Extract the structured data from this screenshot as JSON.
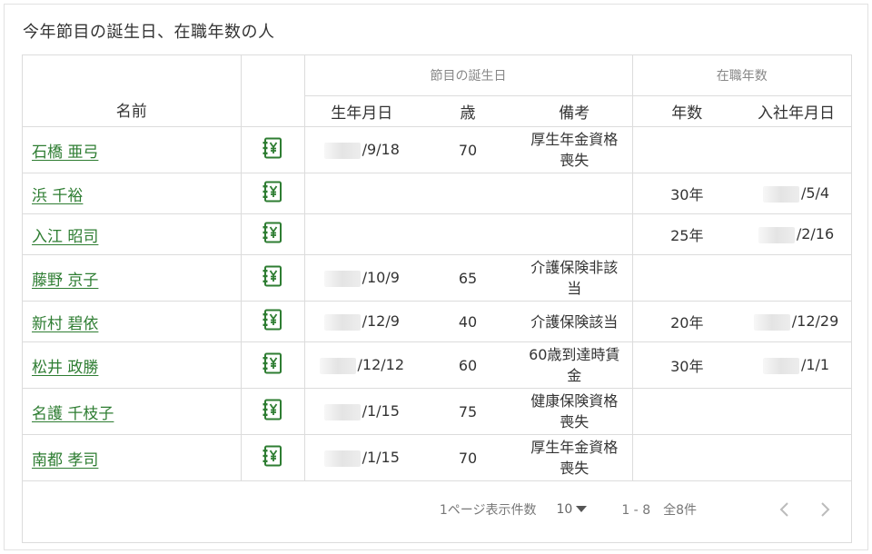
{
  "card_title": "今年節目の誕生日、在職年数の人",
  "headers": {
    "group_birthday": "節目の誕生日",
    "group_tenure": "在職年数",
    "name": "名前",
    "birthdate": "生年月日",
    "age": "歳",
    "note": "備考",
    "years": "年数",
    "join_date": "入社年月日"
  },
  "rows": [
    {
      "name": "石橋 亜弓",
      "birth": "/9/18",
      "age": "70",
      "note": "厚生年金資格喪失",
      "years": "",
      "join": ""
    },
    {
      "name": "浜 千裕",
      "birth": "",
      "age": "",
      "note": "",
      "years": "30年",
      "join": "/5/4"
    },
    {
      "name": "入江 昭司",
      "birth": "",
      "age": "",
      "note": "",
      "years": "25年",
      "join": "/2/16"
    },
    {
      "name": "藤野 京子",
      "birth": "/10/9",
      "age": "65",
      "note": "介護保険非該当",
      "years": "",
      "join": ""
    },
    {
      "name": "新村 碧依",
      "birth": "/12/9",
      "age": "40",
      "note": "介護保険該当",
      "years": "20年",
      "join": "/12/29"
    },
    {
      "name": "松井 政勝",
      "birth": "/12/12",
      "age": "60",
      "note": "60歳到達時賃金",
      "years": "30年",
      "join": "/1/1"
    },
    {
      "name": "名護 千枝子",
      "birth": "/1/15",
      "age": "75",
      "note": "健康保険資格喪失",
      "years": "",
      "join": ""
    },
    {
      "name": "南都 孝司",
      "birth": "/1/15",
      "age": "70",
      "note": "厚生年金資格喪失",
      "years": "",
      "join": ""
    }
  ],
  "pagination": {
    "rows_per_page_label": "1ページ表示件数",
    "rows_per_page_value": "10",
    "range_text": "1 - 8　全8件"
  },
  "colors": {
    "link": "#2e7d32",
    "icon": "#2e7d32",
    "border": "#dcdcdc"
  },
  "icons": {
    "row_icon": "ledger-yen-icon",
    "prev": "chevron-left-icon",
    "next": "chevron-right-icon",
    "dropdown": "caret-down-icon"
  }
}
